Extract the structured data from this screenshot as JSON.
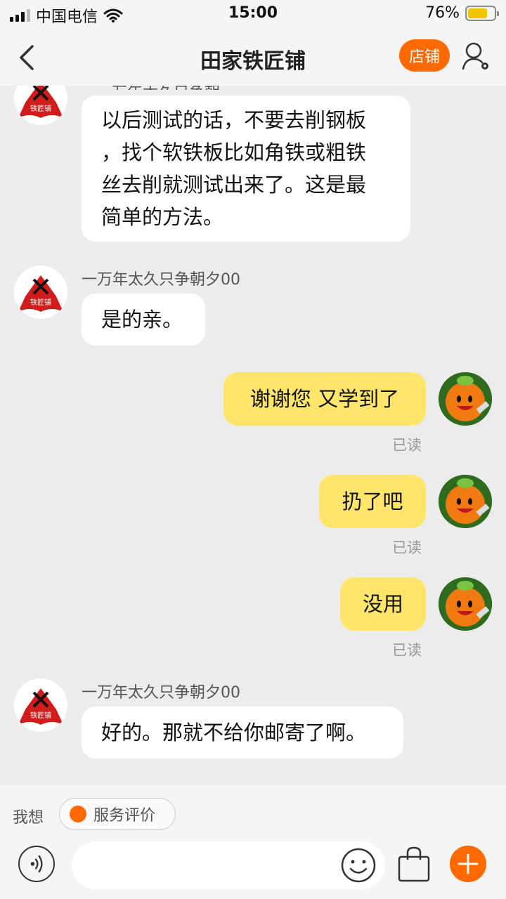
{
  "status_bar": {
    "carrier": "中国电信",
    "time": "15:00",
    "battery_percent": "76%",
    "battery_level": 0.76
  },
  "nav": {
    "title": "田家铁匠铺",
    "shop_button": "店铺"
  },
  "messages": [
    {
      "side": "in",
      "sender": "",
      "text_lines": [
        "以后测试的话，不要去削钢板",
        "，找个软铁板比如角铁或粗铁",
        "丝去削就测试出来了。这是最",
        "简单的方法。"
      ]
    },
    {
      "side": "in",
      "sender": "一万年太久只争朝夕00",
      "text_lines": [
        "是的亲。"
      ]
    },
    {
      "side": "out",
      "text_lines": [
        "谢谢您 又学到了"
      ],
      "status": "已读"
    },
    {
      "side": "out",
      "text_lines": [
        "扔了吧"
      ],
      "status": "已读"
    },
    {
      "side": "out",
      "text_lines": [
        "没用"
      ],
      "status": "已读"
    },
    {
      "side": "in",
      "sender": "一万年太久只争朝夕00",
      "text_lines": [
        "好的。那就不给你邮寄了啊。"
      ]
    }
  ],
  "avatar_text": "铁匠铺",
  "bottom": {
    "want_label": "我想",
    "chip_label": "服务评价",
    "input_placeholder": ""
  },
  "colors": {
    "accent": "#ff6a00",
    "out_bubble": "#ffe56a",
    "in_bubble": "#ffffff",
    "background": "#ececec"
  }
}
